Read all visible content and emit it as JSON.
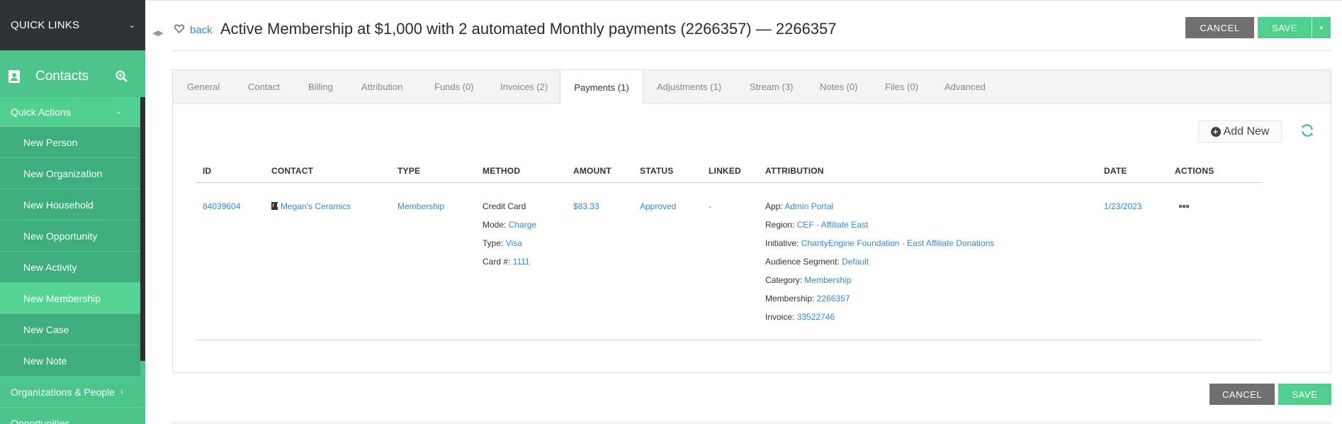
{
  "sidebar": {
    "quick_links": "QUICK LINKS",
    "contacts_title": "Contacts",
    "quick_actions": "Quick Actions",
    "items": [
      {
        "label": "New Person"
      },
      {
        "label": "New Organization"
      },
      {
        "label": "New Household"
      },
      {
        "label": "New Opportunity"
      },
      {
        "label": "New Activity"
      },
      {
        "label": "New Membership"
      },
      {
        "label": "New Case"
      },
      {
        "label": "New Note"
      }
    ],
    "active_item": "New Membership",
    "sections": [
      {
        "label": "Organizations & People"
      },
      {
        "label": "Opportunities"
      }
    ]
  },
  "header": {
    "back_label": "back",
    "title": "Active Membership at $1,000 with 2 automated Monthly payments (2266357) — 2266357",
    "cancel_label": "CANCEL",
    "save_label": "SAVE"
  },
  "tabs": [
    {
      "label": "General"
    },
    {
      "label": "Contact"
    },
    {
      "label": "Billing"
    },
    {
      "label": "Attribution"
    },
    {
      "label": "Funds (0)"
    },
    {
      "label": "Invoices (2)"
    },
    {
      "label": "Payments (1)"
    },
    {
      "label": "Adjustments (1)"
    },
    {
      "label": "Stream (3)"
    },
    {
      "label": "Notes (0)"
    },
    {
      "label": "Files (0)"
    },
    {
      "label": "Advanced"
    }
  ],
  "active_tab": "Payments (1)",
  "toolbar": {
    "add_new_label": "Add New"
  },
  "table": {
    "columns": [
      "ID",
      "CONTACT",
      "TYPE",
      "METHOD",
      "AMOUNT",
      "STATUS",
      "LINKED",
      "ATTRIBUTION",
      "DATE",
      "ACTIONS"
    ],
    "row": {
      "id": "84039604",
      "contact": "Megan's Ceramics",
      "type": "Membership",
      "method": {
        "name": "Credit Card",
        "mode_label": "Mode:",
        "mode": "Charge",
        "type_label": "Type:",
        "type": "Visa",
        "card_label": "Card #:",
        "card": "1111"
      },
      "amount": "$83.33",
      "status": "Approved",
      "linked": "-",
      "attribution": {
        "app_label": "App:",
        "app": "Admin Portal",
        "region_label": "Region:",
        "region": "CEF - Affiliate East",
        "initiative_label": "Initiative:",
        "initiative": "CharityEngine Foundation - East Affiliate Donations",
        "segment_label": "Audience Segment:",
        "segment": "Default",
        "category_label": "Category:",
        "category": "Membership",
        "membership_label": "Membership:",
        "membership": "2266357",
        "invoice_label": "Invoice:",
        "invoice": "33522746"
      },
      "date": "1/23/2023"
    }
  },
  "footer": {
    "cancel_label": "CANCEL",
    "save_label": "SAVE"
  },
  "colors": {
    "sidebar_green": "#4cc58c",
    "accent_green": "#4fd08f",
    "link_blue": "#3a87c8",
    "dark_bar": "#2f3135",
    "cancel_gray": "#6f6f6f"
  }
}
